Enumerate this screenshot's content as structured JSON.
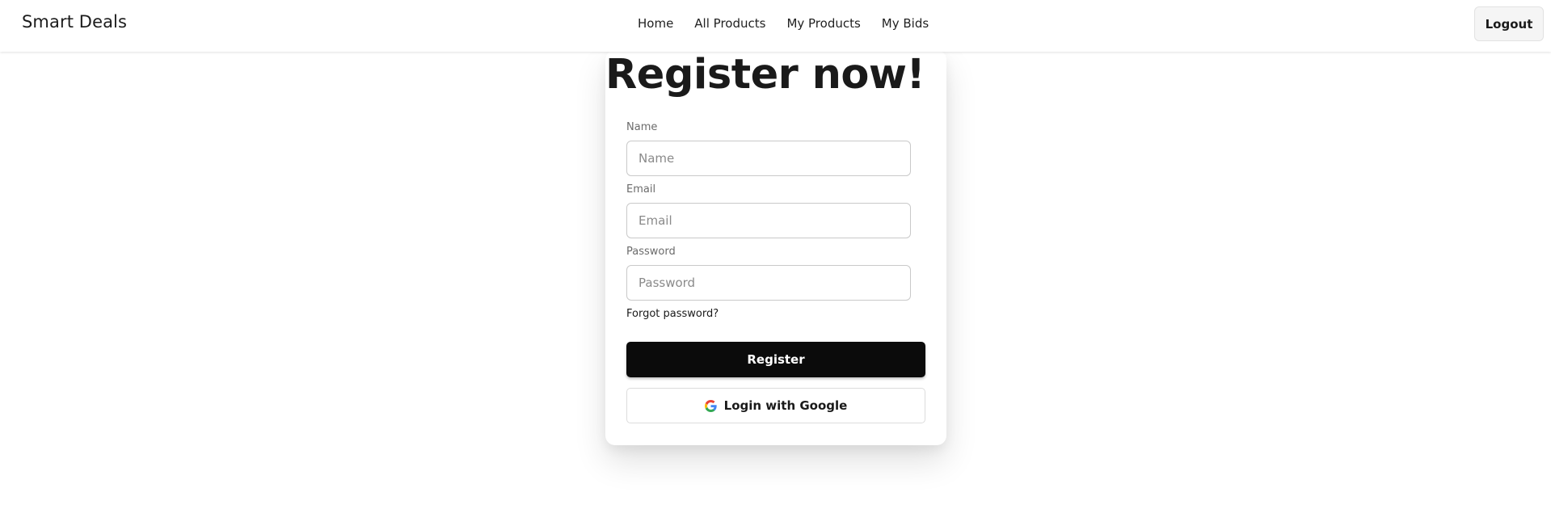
{
  "navbar": {
    "brand": "Smart Deals",
    "links": [
      "Home",
      "All Products",
      "My Products",
      "My Bids"
    ],
    "logout_label": "Logout"
  },
  "form": {
    "title": "Register now!",
    "name": {
      "label": "Name",
      "placeholder": "Name",
      "value": ""
    },
    "email": {
      "label": "Email",
      "placeholder": "Email",
      "value": ""
    },
    "password": {
      "label": "Password",
      "placeholder": "Password",
      "value": ""
    },
    "forgot_label": "Forgot password?",
    "register_label": "Register",
    "google_label": "Login with Google",
    "google_icon": "google-icon"
  },
  "colors": {
    "primary_button": "#0b0b0b",
    "background": "#ffffff",
    "input_border": "#c9c9c9"
  }
}
